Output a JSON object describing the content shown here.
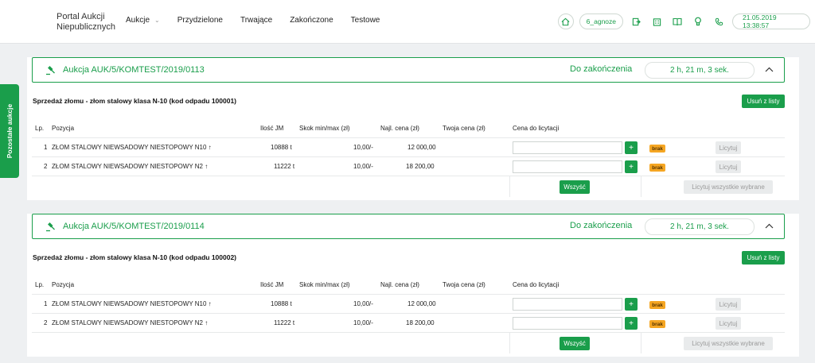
{
  "header": {
    "brand_line1": "Portal Aukcji",
    "brand_line2": "Niepublicznych",
    "nav": [
      "Aukcje",
      "Przydzielone",
      "Trwające",
      "Zakończone",
      "Testowe"
    ],
    "user": "6_agnoze",
    "datetime": "21.05.2019 13:38:57"
  },
  "side_tab": "Pozostałe aukcje",
  "columns": {
    "lp": "Lp.",
    "pos": "Pozycja",
    "qty": "Ilość JM",
    "step": "Skok min/max (zł)",
    "best": "Najl. cena (zł)",
    "your": "Twoja cena (zł)",
    "bid": "Cena do licytacji"
  },
  "labels": {
    "ends_in": "Do zakończenia",
    "remove": "Usuń z listy",
    "all": "Wszystkie",
    "bid": "Licytuj",
    "bid_all": "Licytuj wszystkie wybrane",
    "badge": "brak",
    "plus": "+"
  },
  "auctions": [
    {
      "title": "Aukcja AUK/5/KOMTEST/2019/0113",
      "timer": "2 h, 21 m, 3 sek.",
      "lot": "Sprzedaż złomu - złom stalowy klasa N-10 (kod odpadu 100001)",
      "all_label": "Wszyść",
      "rows": [
        {
          "lp": "1",
          "pos": "ZŁOM STALOWY NIEWSADOWY NIESTOPOWY N10",
          "qty": "10888 t",
          "step": "10,00/-",
          "best": "12 000,00"
        },
        {
          "lp": "2",
          "pos": "ZŁOM STALOWY NIEWSADOWY NIESTOPOWY N2",
          "qty": "11222 t",
          "step": "10,00/-",
          "best": "18 200,00"
        }
      ]
    },
    {
      "title": "Aukcja AUK/5/KOMTEST/2019/0114",
      "timer": "2 h, 21 m, 3 sek.",
      "lot": "Sprzedaż złomu - złom stalowy klasa N-10 (kod odpadu 100002)",
      "all_label": "Wszyść",
      "rows": [
        {
          "lp": "1",
          "pos": "ZŁOM STALOWY NIEWSADOWY NIESTOPOWY N10",
          "qty": "10888 t",
          "step": "10,00/-",
          "best": "12 000,00"
        },
        {
          "lp": "2",
          "pos": "ZŁOM STALOWY NIEWSADOWY NIESTOPOWY N2",
          "qty": "11222 t",
          "step": "10,00/-",
          "best": "18 200,00"
        }
      ]
    }
  ],
  "colors": {
    "accent": "#1a9e4b",
    "badge": "#f5a623"
  }
}
